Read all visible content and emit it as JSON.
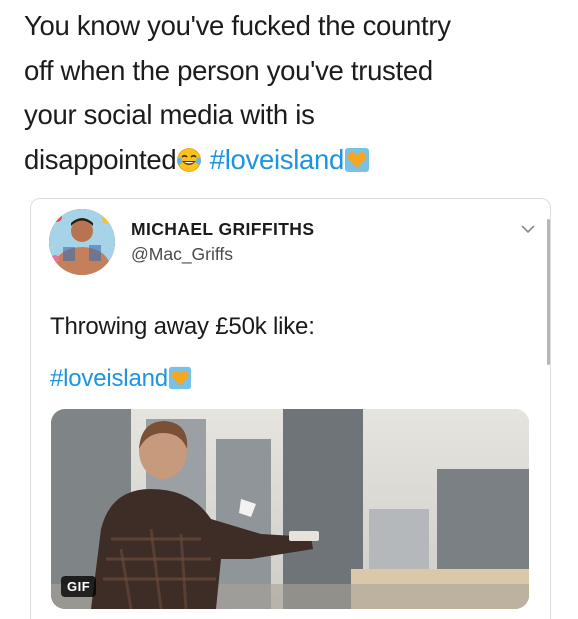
{
  "caption": {
    "line1": "You know you've fucked the country",
    "line2": "off when the person you've trusted",
    "line3": "your social media with is",
    "line4_text": "disappointed",
    "hashtag": "#loveisland"
  },
  "tweet": {
    "display_name": "MICHAEL GRIFFITHS",
    "handle": "@Mac_Griffs",
    "text": "Throwing away £50k like:",
    "hashtag": "#loveisland",
    "media_badge": "GIF"
  },
  "icons": {
    "laughing": "face-with-tears-of-joy-icon",
    "heart": "heart-box-icon",
    "chevron": "chevron-down-icon"
  },
  "colors": {
    "hashtag": "#1b95e0",
    "text": "#1c1c1c",
    "border": "#dcdcdc"
  }
}
